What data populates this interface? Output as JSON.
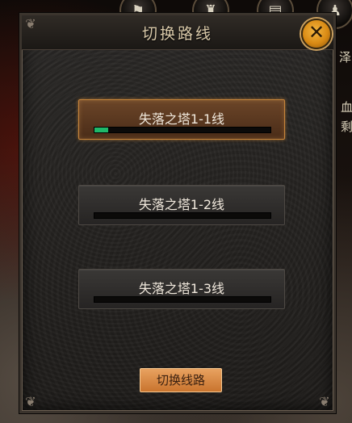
{
  "background": {
    "top_icons": [
      "flag-icon",
      "castle-icon",
      "scroll-icon",
      "character-icon"
    ],
    "side_texts": [
      "血",
      "剩",
      "泽"
    ]
  },
  "dialog": {
    "title": "切换路线",
    "close_symbol": "✕",
    "lines": [
      {
        "label": "失落之塔1-1线",
        "load": 0.08,
        "selected": true
      },
      {
        "label": "失落之塔1-2线",
        "load": 0.0,
        "selected": false
      },
      {
        "label": "失落之塔1-3线",
        "load": 0.0,
        "selected": false
      }
    ],
    "switch_button": "切换线路"
  },
  "colors": {
    "load_bar": "#1fb86a",
    "selected_border": "#c8853a",
    "close_button": "#e09a20"
  }
}
